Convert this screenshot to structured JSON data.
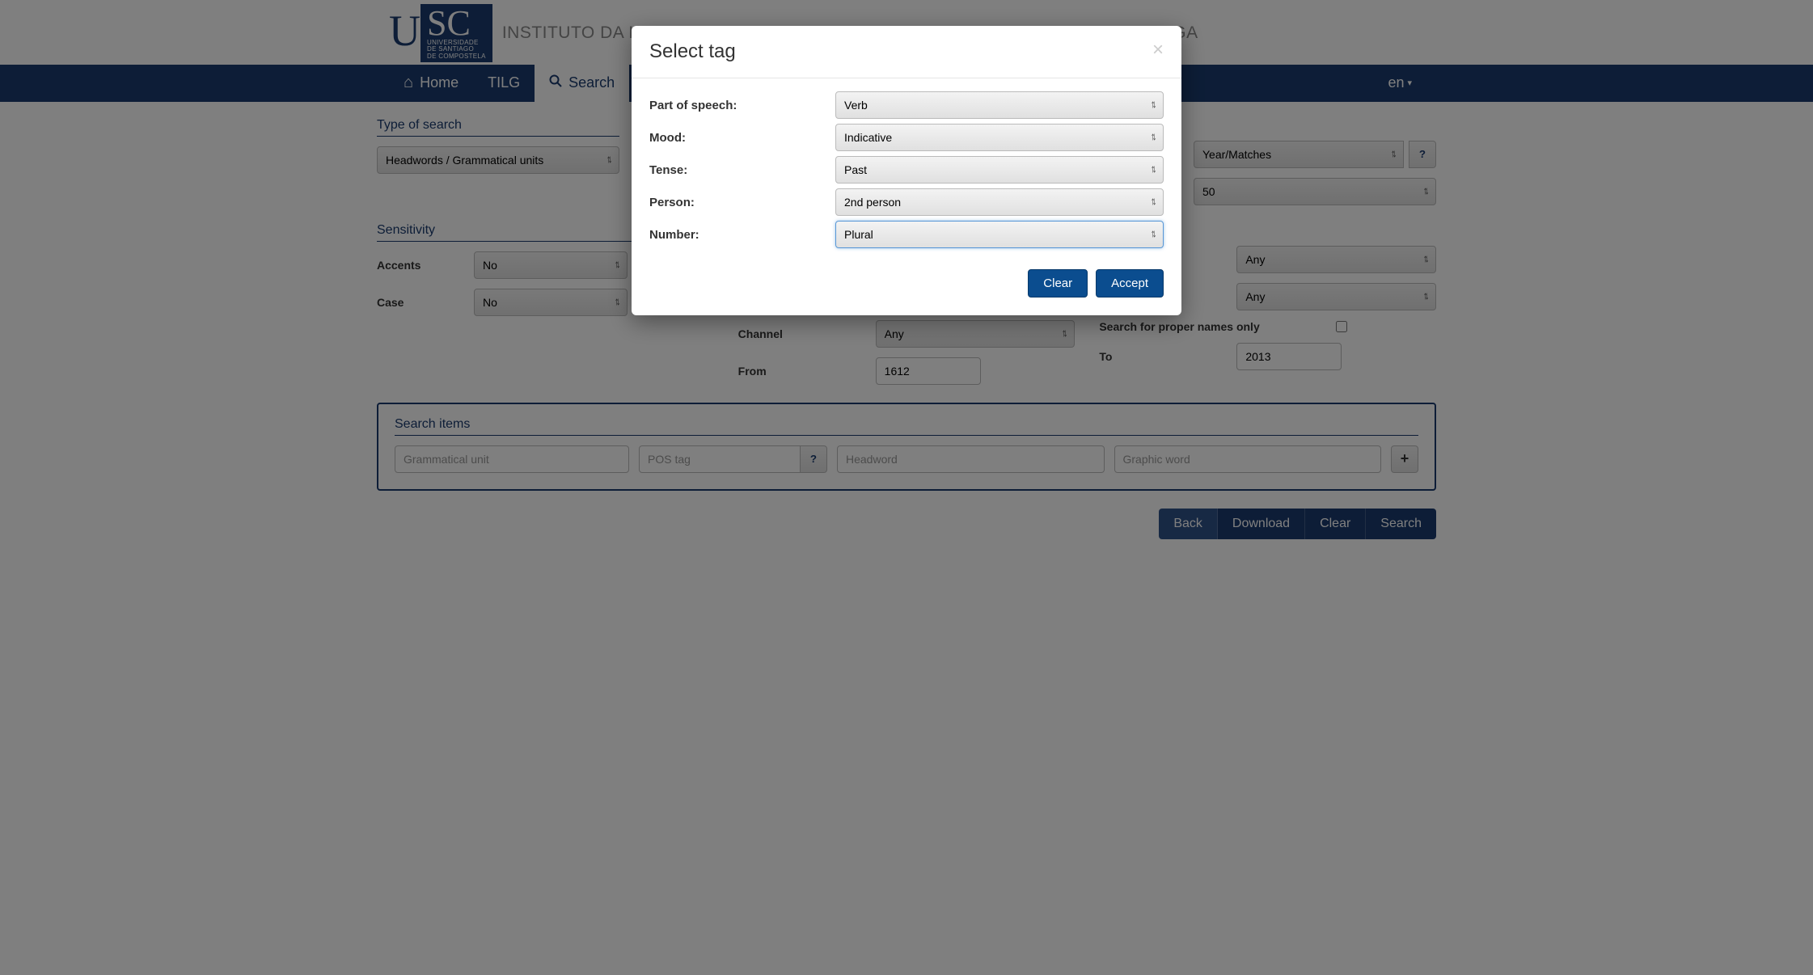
{
  "header": {
    "logo_small_line1": "UNIVERSIDADE",
    "logo_small_line2": "DE SANTIAGO",
    "logo_small_line3": "DE COMPOSTELA",
    "title": "INSTITUTO DA LINGUA GALEGA - TESOURO INFORMATIZADO DA LINGUA GALEGA"
  },
  "nav": {
    "home": "Home",
    "tilg": "TILG",
    "search": "Search",
    "lang": "en"
  },
  "form": {
    "type_of_search_title": "Type of search",
    "type_of_search_value": "Headwords / Grammatical units",
    "year_matches_label": "Year/Matches",
    "year_matches_value": "50",
    "sensitivity_title": "Sensitivity",
    "accents_label": "Accents",
    "accents_value": "No",
    "case_label": "Case",
    "case_value": "No",
    "any": "Any",
    "channel_label": "Channel",
    "channel_value": "Any",
    "proper_names_label": "Search for proper names only",
    "from_label": "From",
    "from_value": "1612",
    "to_label": "To",
    "to_value": "2013"
  },
  "search_items": {
    "title": "Search items",
    "gram_unit_ph": "Grammatical unit",
    "pos_tag_ph": "POS tag",
    "headword_ph": "Headword",
    "graphic_word_ph": "Graphic word"
  },
  "bottom": {
    "back": "Back",
    "download": "Download",
    "clear": "Clear",
    "search": "Search"
  },
  "modal": {
    "title": "Select tag",
    "pos_label": "Part of speech:",
    "pos_value": "Verb",
    "mood_label": "Mood:",
    "mood_value": "Indicative",
    "tense_label": "Tense:",
    "tense_value": "Past",
    "person_label": "Person:",
    "person_value": "2nd person",
    "number_label": "Number:",
    "number_value": "Plural",
    "clear": "Clear",
    "accept": "Accept"
  }
}
